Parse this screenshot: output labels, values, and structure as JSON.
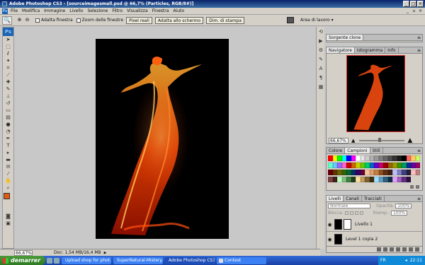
{
  "window": {
    "title": "Adobe Photoshop CS3 - [sourceimagesmall.psd @ 66,7% (Particles, RGB/8#)]"
  },
  "menu": [
    "File",
    "Modifica",
    "Immagine",
    "Livello",
    "Selezione",
    "Filtro",
    "Visualizza",
    "Finestra",
    "Aiuto"
  ],
  "options": {
    "adatta": "Adatta finestra",
    "zoom_tutte": "Zoom delle finestre",
    "pixel_reali": "Pixel reali",
    "adatta_schermo": "Adatta allo schermo",
    "dim_stampa": "Dim. di stampa",
    "area": "Area di lavoro"
  },
  "status": {
    "zoom": "66,67%",
    "doc": "Doc: 1,54 MB/16,4 MB"
  },
  "panels": {
    "clone_tab": "Sorgente clone",
    "nav_tabs": [
      "Navigatore",
      "Istogramma",
      "Info"
    ],
    "nav_zoom": "66,67%",
    "nav_zoom_level": 0.44,
    "color_tabs": [
      "Colore",
      "Campioni",
      "Stili"
    ],
    "layer_tabs": [
      "Livelli",
      "Canali",
      "Tracciati"
    ],
    "blend_mode": "Normale",
    "opacity_label": "Opacità:",
    "opacity": "100%",
    "lock_label": "Blocca:",
    "fill_label": "Riemp.:",
    "fill": "100%",
    "layers": [
      {
        "name": "Livello 1"
      },
      {
        "name": "Level 1 copia 2"
      }
    ]
  },
  "swatches": [
    "#ff0000",
    "#ffff00",
    "#00ff00",
    "#00ffff",
    "#0000ff",
    "#ff00ff",
    "#ffffff",
    "#e6e6e6",
    "#cccccc",
    "#b3b3b3",
    "#999999",
    "#808080",
    "#666666",
    "#4d4d4d",
    "#333333",
    "#1a1a1a",
    "#000000",
    "#ff6666",
    "#ffcc66",
    "#ccff66",
    "#66ffcc",
    "#66ccff",
    "#9966ff",
    "#ff66cc",
    "#cc0000",
    "#cc6600",
    "#cccc00",
    "#66cc00",
    "#00cc66",
    "#0066cc",
    "#6600cc",
    "#cc0066",
    "#990000",
    "#996600",
    "#999900",
    "#339900",
    "#009966",
    "#003399",
    "#660099",
    "#990066",
    "#660000",
    "#663300",
    "#666600",
    "#336600",
    "#006633",
    "#003366",
    "#330066",
    "#660033",
    "#f7c8a0",
    "#e0a070",
    "#c08040",
    "#905020",
    "#603010",
    "#402010",
    "#c0c0ff",
    "#8080c0",
    "#404080",
    "#202040",
    "#ffc0c0",
    "#c08080",
    "#804040",
    "#402020",
    "#c0ffc0",
    "#80c080",
    "#408040",
    "#204020",
    "#ffe0a0",
    "#c0a060",
    "#806030",
    "#403010",
    "#a0e0ff",
    "#60a0c0",
    "#306080",
    "#103040",
    "#e0a0ff",
    "#a060c0",
    "#603080",
    "#301040"
  ],
  "taskbar": {
    "start": "demarrer",
    "tasks": [
      "Upload shop for phot...",
      "SuperNatural-Mistery...",
      "Adobe Photoshop CS3 ...",
      "Contest"
    ],
    "lang": "FR",
    "clock": "22:11"
  }
}
